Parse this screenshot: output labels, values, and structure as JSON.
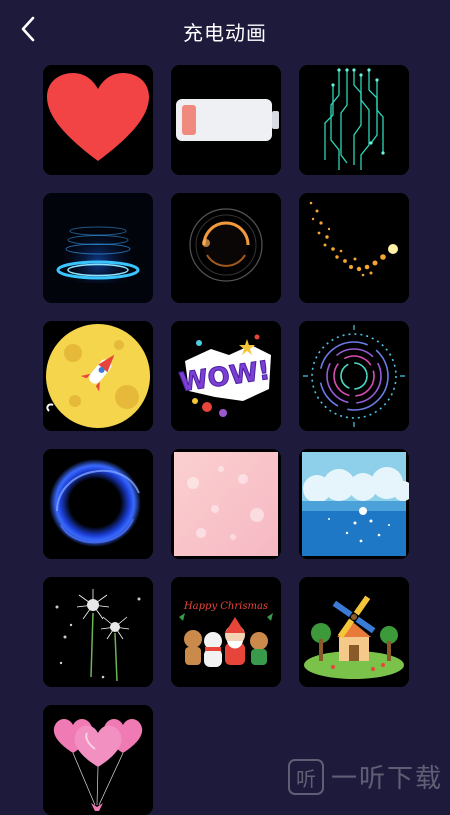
{
  "header": {
    "title": "充电动画",
    "back_icon": "chevron-left-icon"
  },
  "tiles": [
    {
      "name": "heart",
      "icon": "heart-icon"
    },
    {
      "name": "battery",
      "icon": "battery-low-icon"
    },
    {
      "name": "circuit",
      "icon": "circuit-lines-icon"
    },
    {
      "name": "hologram",
      "icon": "hologram-rings-icon"
    },
    {
      "name": "eclipse",
      "icon": "eclipse-ring-icon"
    },
    {
      "name": "sparkle-comet",
      "icon": "sparkle-comet-icon"
    },
    {
      "name": "moon-rocket",
      "icon": "moon-rocket-icon"
    },
    {
      "name": "wow",
      "icon": "wow-sticker-icon",
      "text": "WOW!"
    },
    {
      "name": "radial-rings",
      "icon": "radial-rings-icon"
    },
    {
      "name": "blue-vortex",
      "icon": "blue-vortex-icon"
    },
    {
      "name": "pink-bokeh",
      "icon": "pink-bokeh-icon"
    },
    {
      "name": "sea-clouds",
      "icon": "sea-clouds-icon"
    },
    {
      "name": "dandelion",
      "icon": "dandelion-icon"
    },
    {
      "name": "christmas",
      "icon": "christmas-characters-icon",
      "text": "Happy Chrismas"
    },
    {
      "name": "windmill",
      "icon": "windmill-house-icon"
    },
    {
      "name": "heart-balloons",
      "icon": "heart-balloons-icon"
    }
  ],
  "watermark": {
    "text": "一听下载",
    "icon": "yiting-logo-icon"
  }
}
